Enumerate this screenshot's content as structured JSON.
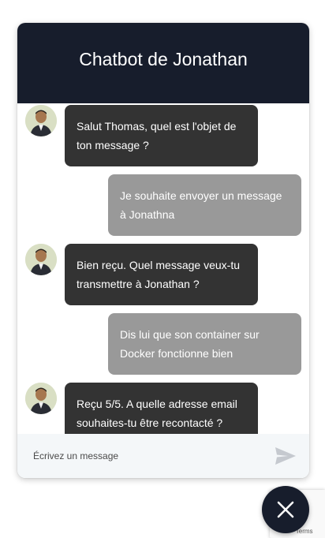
{
  "header": {
    "title": "Chatbot de Jonathan"
  },
  "messages": [
    {
      "sender": "bot",
      "text": "Salut Thomas, quel est l'objet de ton message ?"
    },
    {
      "sender": "user",
      "text": "Je souhaite envoyer un message à Jonathna"
    },
    {
      "sender": "bot",
      "text": "Bien reçu. Quel message veux-tu transmettre à Jonathan ?"
    },
    {
      "sender": "user",
      "text": "Dis lui que son container sur Docker fonctionne bien"
    },
    {
      "sender": "bot",
      "text": "Reçu 5/5. A quelle adresse email souhaites-tu être recontacté ?"
    }
  ],
  "composer": {
    "placeholder": "Écrivez un message",
    "send_icon": "send-icon"
  },
  "launcher": {
    "icon": "close-icon"
  },
  "recaptcha": {
    "terms": "· Terms"
  },
  "colors": {
    "header_bg": "#171d2c",
    "bot_bubble": "#333333",
    "user_bubble": "#999999",
    "footer_bg": "#f4f7f9"
  }
}
